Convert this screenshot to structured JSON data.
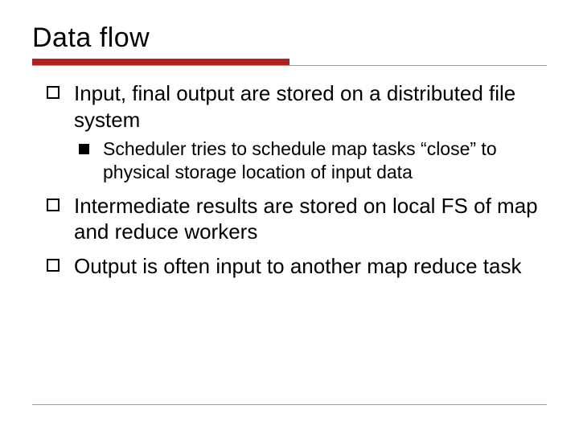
{
  "title": "Data flow",
  "bullets": [
    {
      "text": "Input, final output are stored on a distributed file system",
      "children": [
        {
          "text": "Scheduler tries to schedule map tasks “close” to physical storage location of input data"
        }
      ]
    },
    {
      "text": "Intermediate results are stored on local FS of map and reduce workers",
      "children": []
    },
    {
      "text": "Output is often input to another map reduce task",
      "children": []
    }
  ]
}
